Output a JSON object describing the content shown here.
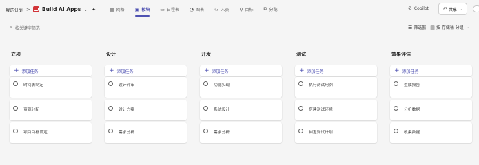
{
  "breadcrumb": {
    "my_plans": "我的计划",
    "separator": ">"
  },
  "app": {
    "title": "Build AI Apps",
    "accent": "#d13438"
  },
  "views": [
    {
      "label": "网格",
      "icon": "grid-icon",
      "active": false
    },
    {
      "label": "板块",
      "icon": "board-icon",
      "active": true
    },
    {
      "label": "日程表",
      "icon": "schedule-icon",
      "active": false
    },
    {
      "label": "图表",
      "icon": "chart-icon",
      "active": false
    },
    {
      "label": "人员",
      "icon": "people-icon",
      "active": false
    },
    {
      "label": "目标",
      "icon": "goal-icon",
      "active": false
    },
    {
      "label": "分配",
      "icon": "assign-icon",
      "active": false
    }
  ],
  "header": {
    "copilot": "Copilot",
    "share": "共享"
  },
  "filter_bar": {
    "search_placeholder": "按关键字筛选",
    "filter_label": "筛选器",
    "group_label": "按 存储桶 分组"
  },
  "columns": [
    {
      "title": "立项",
      "add_label": "添加任务",
      "tasks": [
        "时间表制定",
        "资源分配",
        "项目目标设定"
      ]
    },
    {
      "title": "设计",
      "add_label": "添加任务",
      "tasks": [
        "设计评审",
        "设计方案",
        "需求分析"
      ]
    },
    {
      "title": "开发",
      "add_label": "添加任务",
      "tasks": [
        "功能实现",
        "系统设计",
        "需求分析"
      ]
    },
    {
      "title": "测试",
      "add_label": "添加任务",
      "tasks": [
        "执行测试用例",
        "搭建测试环境",
        "制定测试计划"
      ]
    },
    {
      "title": "效果评估",
      "add_label": "添加任务",
      "tasks": [
        "生成报告",
        "分析数据",
        "收集数据"
      ]
    }
  ],
  "colors": {
    "accent": "#4f52b2",
    "background": "#f5f5f5"
  }
}
